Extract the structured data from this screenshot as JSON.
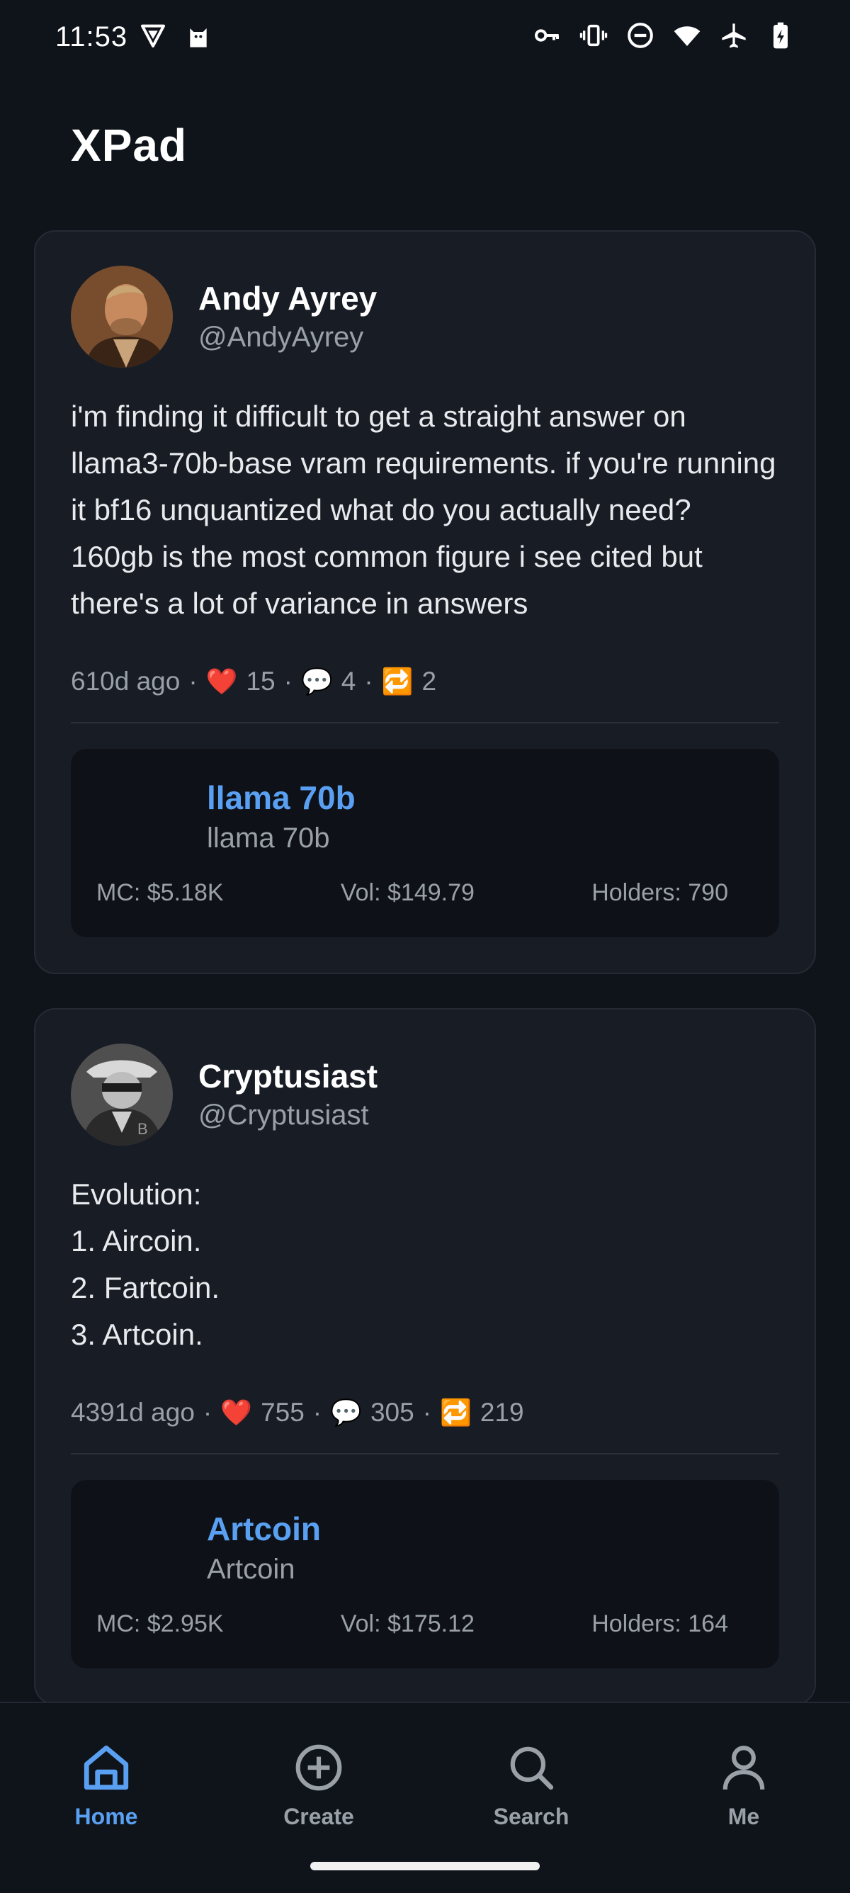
{
  "status_bar": {
    "time": "11:53"
  },
  "app": {
    "logo_x": "X",
    "logo_rest": "Pad"
  },
  "posts": [
    {
      "author_name": "Andy Ayrey",
      "author_handle": "@AndyAyrey",
      "text": "i'm finding it difficult to get a straight answer on llama3-70b-base vram requirements. if you're running it bf16 unquantized what do you actually need? 160gb is the most common figure i see cited but there's a lot of variance in answers",
      "age": "610d ago",
      "likes": "15",
      "comments": "4",
      "retweets": "2",
      "token": {
        "name": "llama 70b",
        "subtitle": "llama 70b",
        "mc": "MC: $5.18K",
        "vol": "Vol: $149.79",
        "holders": "Holders: 790"
      }
    },
    {
      "author_name": "Cryptusiast",
      "author_handle": "@Cryptusiast",
      "text": "Evolution:\n1. Aircoin.\n2. Fartcoin.\n3. Artcoin.",
      "age": "4391d ago",
      "likes": "755",
      "comments": "305",
      "retweets": "219",
      "token": {
        "name": "Artcoin",
        "subtitle": "Artcoin",
        "mc": "MC: $2.95K",
        "vol": "Vol: $175.12",
        "holders": "Holders: 164"
      }
    }
  ],
  "stats_separator": "·",
  "icons": {
    "like": "❤️",
    "comment": "💬",
    "retweet": "🔁"
  },
  "nav": {
    "items": [
      {
        "label": "Home",
        "icon": "home-icon",
        "active": true
      },
      {
        "label": "Create",
        "icon": "plus-circle-icon",
        "active": false
      },
      {
        "label": "Search",
        "icon": "search-icon",
        "active": false
      },
      {
        "label": "Me",
        "icon": "user-icon",
        "active": false
      }
    ]
  },
  "colors": {
    "accent": "#5aa0f2",
    "background": "#0f141b",
    "card": "#181d25"
  }
}
